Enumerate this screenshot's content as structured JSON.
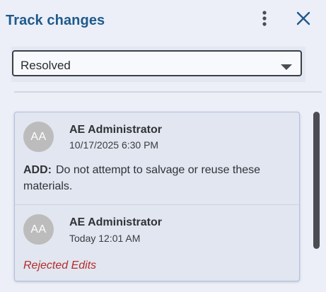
{
  "header": {
    "title": "Track changes",
    "more_icon": "more-vertical-icon",
    "close_icon": "close-icon"
  },
  "filter": {
    "selected": "Resolved",
    "caret_icon": "caret-down-icon"
  },
  "changes": [
    {
      "avatar_initials": "AA",
      "author": "AE Administrator",
      "timestamp": "10/17/2025 6:30 PM",
      "change_type": "ADD:",
      "text": "Do not attempt to salvage or reuse these materials."
    },
    {
      "avatar_initials": "AA",
      "author": "AE Administrator",
      "timestamp": "Today 12:01 AM",
      "status": "Rejected Edits"
    }
  ],
  "colors": {
    "title": "#1f5a8c",
    "status_rejected": "#b42b2b",
    "avatar_bg": "#bcbcbc",
    "card_border": "#b3c1de",
    "panel_bg": "#eceff7"
  }
}
